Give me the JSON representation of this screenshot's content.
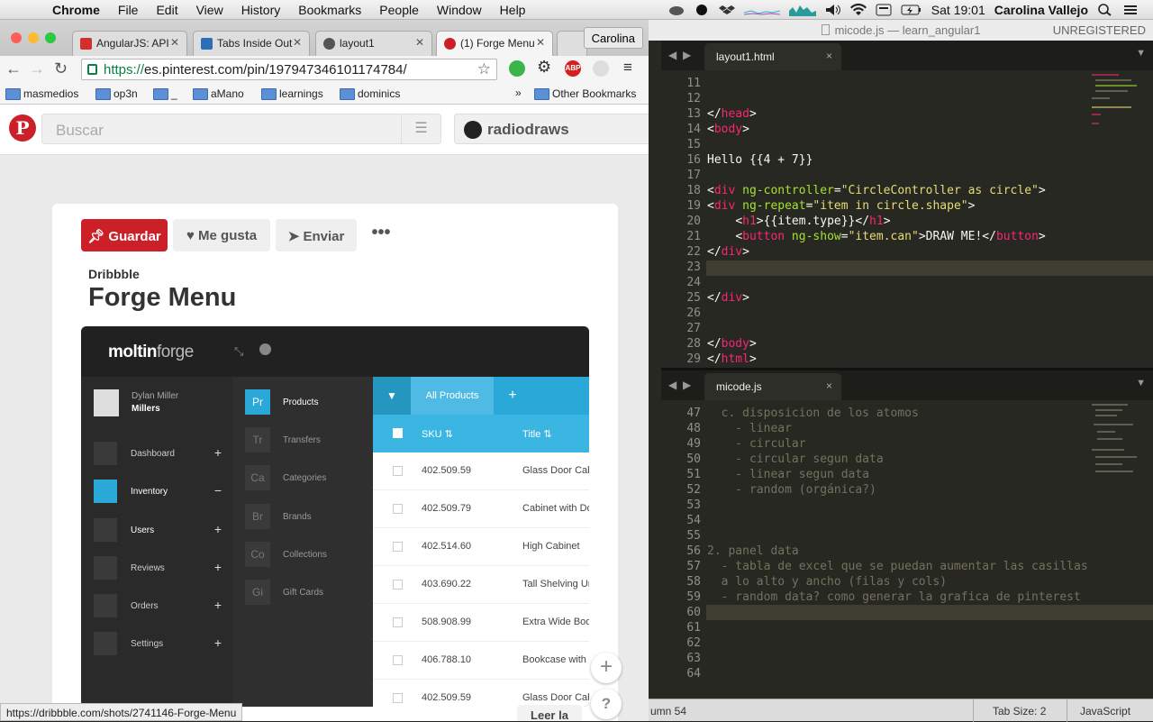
{
  "menubar": {
    "app": "Chrome",
    "items": [
      "File",
      "Edit",
      "View",
      "History",
      "Bookmarks",
      "People",
      "Window",
      "Help"
    ],
    "clock": "Sat 19:01",
    "user": "Carolina Vallejo"
  },
  "chrome": {
    "tabs": [
      {
        "title": "AngularJS: API",
        "color": "#d32f2f"
      },
      {
        "title": "Tabs Inside Out",
        "color": "#2d6fb5"
      },
      {
        "title": "layout1",
        "color": "#555555"
      },
      {
        "title": "(1) Forge Menu",
        "color": "#cb2027"
      }
    ],
    "profile": "Carolina",
    "url_scheme": "https://",
    "url_rest": "es.pinterest.com/pin/197947346101174784/",
    "bookmarks": [
      "masmedios",
      "op3n",
      "_",
      "aMano",
      "learnings",
      "dominics"
    ],
    "bookmarks_more": "»",
    "other_bookmarks": "Other Bookmarks",
    "status_url": "https://dribbble.com/shots/2741146-Forge-Menu"
  },
  "pinterest": {
    "logo": "P",
    "search_placeholder": "Buscar",
    "username": "radiodraws",
    "save": "Guardar",
    "like": "Me gusta",
    "send": "Enviar",
    "more": "•••",
    "source": "Dribbble",
    "title": "Forge Menu",
    "load_more": "Leer la",
    "fab_plus": "+",
    "fab_help": "?"
  },
  "shot": {
    "logo_a": "moltin",
    "logo_b": "forge",
    "user_name": "Dylan Miller",
    "user_short": "Millers",
    "nav": [
      {
        "label": "Dashboard",
        "mark": "+",
        "active": false
      },
      {
        "label": "Inventory",
        "mark": "−",
        "active": true
      },
      {
        "label": "Users",
        "mark": "+",
        "active": false
      },
      {
        "label": "Reviews",
        "mark": "+",
        "active": false
      },
      {
        "label": "Orders",
        "mark": "+",
        "active": false
      },
      {
        "label": "Settings",
        "mark": "+",
        "active": false
      }
    ],
    "categories": [
      {
        "abbr": "Pr",
        "label": "Products"
      },
      {
        "abbr": "Tr",
        "label": "Transfers"
      },
      {
        "abbr": "Ca",
        "label": "Categories"
      },
      {
        "abbr": "Br",
        "label": "Brands"
      },
      {
        "abbr": "Co",
        "label": "Collections"
      },
      {
        "abbr": "Gi",
        "label": "Gift Cards"
      }
    ],
    "tab_all": "All Products",
    "tab_add": "+",
    "col_sku": "SKU",
    "col_title": "Title",
    "rows": [
      {
        "sku": "402.509.59",
        "title": "Glass Door Cabi"
      },
      {
        "sku": "402.509.79",
        "title": "Cabinet with Do"
      },
      {
        "sku": "402.514.60",
        "title": "High Cabinet"
      },
      {
        "sku": "403.690.22",
        "title": "Tall Shelving Uni"
      },
      {
        "sku": "508.908.99",
        "title": "Extra Wide Boo"
      },
      {
        "sku": "406.788.10",
        "title": "Bookcase with C"
      },
      {
        "sku": "402.509.59",
        "title": "Glass Door Cabi"
      }
    ]
  },
  "sublime": {
    "title": "micode.js — learn_angular1",
    "unregistered": "UNREGISTERED",
    "tab1": "layout1.html",
    "tab2": "micode.js",
    "close": "×",
    "pane1_lines": [
      "11",
      "12",
      "13",
      "14",
      "15",
      "16",
      "17",
      "18",
      "19",
      "20",
      "21",
      "22",
      "23",
      "24",
      "25",
      "26",
      "27",
      "28",
      "29"
    ],
    "pane1": {
      "l13_close": "</",
      "l13_tag": "head",
      "l13_end": ">",
      "l14_open": "<",
      "l14_tag": "body",
      "l14_end": ">",
      "l16": "Hello {{4 + 7}}",
      "l18_a": "<",
      "l18_tag": "div",
      "l18_attr": " ng-controller",
      "l18_eq": "=",
      "l18_val": "\"CircleController as circle\"",
      "l18_end": ">",
      "l19_a": "<",
      "l19_tag": "div",
      "l19_attr": " ng-repeat",
      "l19_eq": "=",
      "l19_val": "\"item in circle.shape\"",
      "l19_end": ">",
      "l20_indent": "    ",
      "l20_a": "<",
      "l20_tag": "h1",
      "l20_mid": ">{{item.type}}</",
      "l20_tag2": "h1",
      "l20_end": ">",
      "l21_indent": "    ",
      "l21_a": "<",
      "l21_tag": "button",
      "l21_attr": " ng-show",
      "l21_eq": "=",
      "l21_val": "\"item.can\"",
      "l21_mid": ">DRAW ME!</",
      "l21_tag2": "button",
      "l21_end": ">",
      "l22_a": "</",
      "l22_tag": "div",
      "l22_end": ">",
      "l25_a": "</",
      "l25_tag": "div",
      "l25_end": ">",
      "l28_a": "</",
      "l28_tag": "body",
      "l28_end": ">",
      "l29_a": "</",
      "l29_tag": "html",
      "l29_end": ">"
    },
    "pane2_lines": [
      "47",
      "48",
      "49",
      "50",
      "51",
      "52",
      "53",
      "54",
      "55",
      "56",
      "57",
      "58",
      "59",
      "60",
      "61",
      "62",
      "63",
      "64"
    ],
    "pane2": [
      "  c. disposicion de los atomos",
      "    - linear",
      "    - circular",
      "    - circular segun data",
      "    - linear segun data",
      "    - random (orgánica?)",
      "",
      "",
      "",
      "2. panel data",
      "  - tabla de excel que se puedan aumentar las casillas",
      "  a lo alto y ancho (filas y cols)",
      "  - random data? como generar la grafica de pinterest",
      "",
      "",
      "",
      "",
      ""
    ],
    "status_col": "umn 54",
    "status_tab": "Tab Size: 2",
    "status_lang": "JavaScript"
  },
  "colors": {
    "pinterest_red": "#cb2027",
    "forge_blue": "#2aa8d7",
    "editor_bg": "#272822"
  }
}
